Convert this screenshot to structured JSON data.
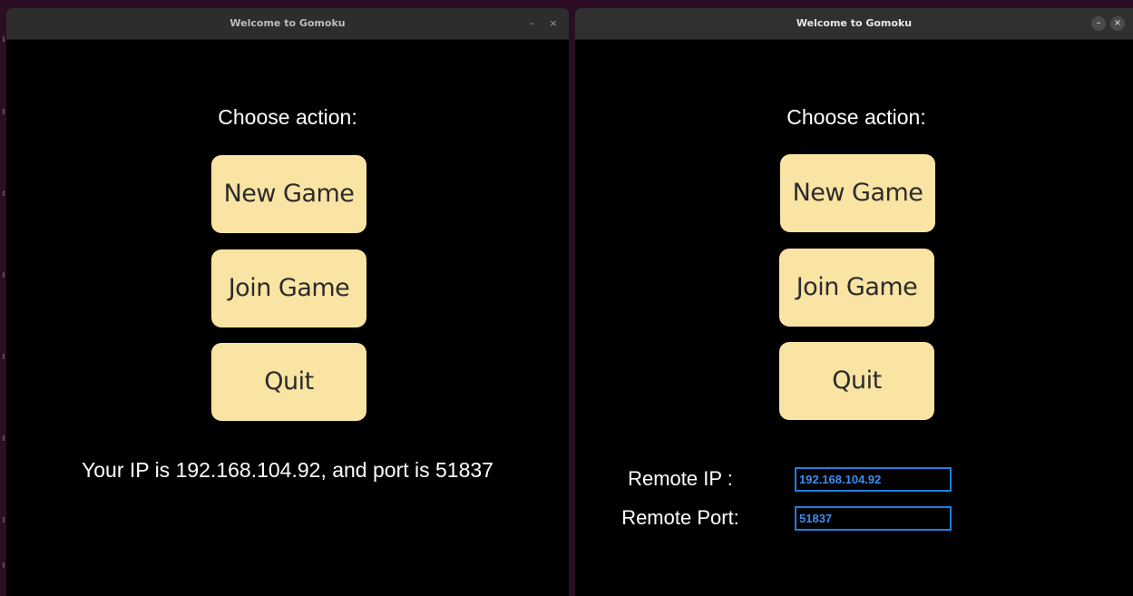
{
  "windows": {
    "left": {
      "title": "Welcome to Gomoku",
      "minimize": "–",
      "close": "×",
      "heading": "Choose action:",
      "buttons": {
        "new_game": "New Game",
        "join_game": "Join Game",
        "quit": "Quit"
      },
      "ip_info": "Your IP is 192.168.104.92, and port is 51837"
    },
    "right": {
      "title": "Welcome to Gomoku",
      "minimize": "–",
      "close": "×",
      "heading": "Choose action:",
      "buttons": {
        "new_game": "New Game",
        "join_game": "Join Game",
        "quit": "Quit"
      },
      "remote_ip_label": "Remote IP :",
      "remote_ip_value": "192.168.104.92",
      "remote_port_label": "Remote Port:",
      "remote_port_value": "51837"
    }
  },
  "colors": {
    "button_bg": "#f9e4a3",
    "field_border": "#1f7fe0",
    "field_text": "#3a8ef0",
    "window_bg": "#000000",
    "titlebar_bg": "#2d2d2d"
  }
}
